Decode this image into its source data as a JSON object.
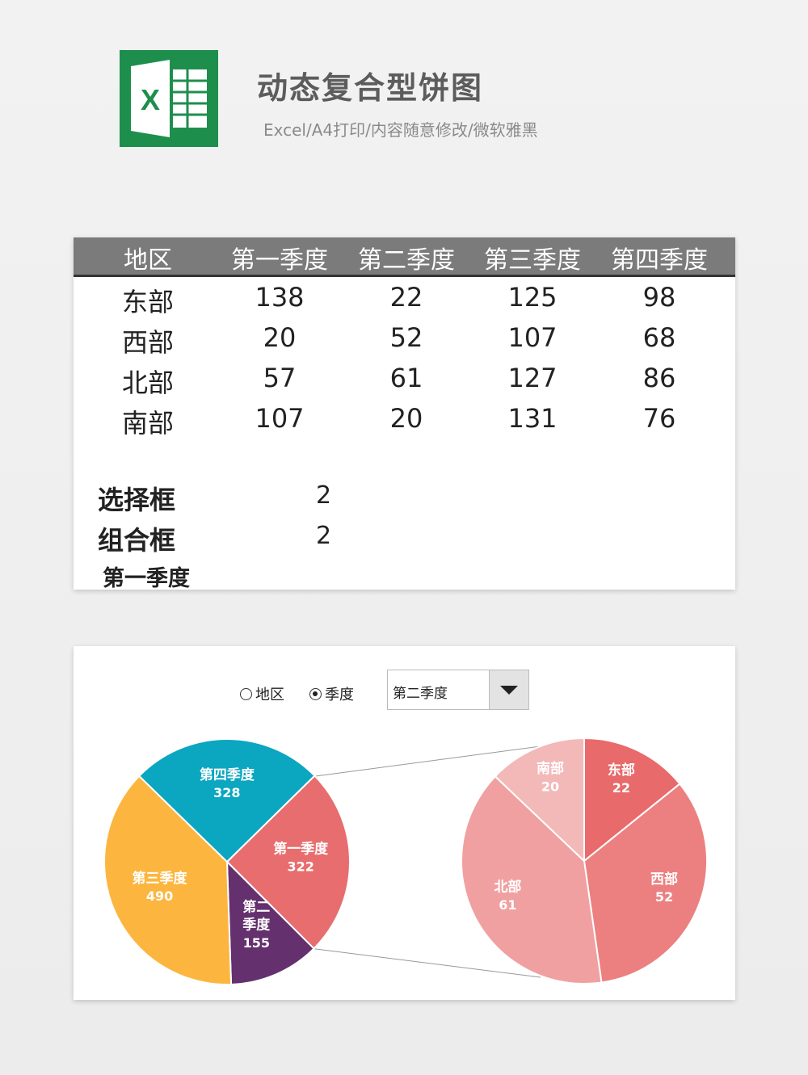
{
  "header": {
    "title": "动态复合型饼图",
    "subtitle": "Excel/A4打印/内容随意修改/微软雅黑",
    "logo_icon": "excel-logo-icon",
    "logo_letter": "X",
    "logo_color": "#1e8e4d"
  },
  "table": {
    "headers": [
      "地区",
      "第一季度",
      "第二季度",
      "第三季度",
      "第四季度"
    ],
    "rows": [
      {
        "region": "东部",
        "values": [
          "138",
          "22",
          "125",
          "98"
        ]
      },
      {
        "region": "西部",
        "values": [
          "20",
          "52",
          "107",
          "68"
        ]
      },
      {
        "region": "北部",
        "values": [
          "57",
          "61",
          "127",
          "86"
        ]
      },
      {
        "region": "南部",
        "values": [
          "107",
          "20",
          "131",
          "76"
        ]
      }
    ],
    "header_color": "#7b7b7b"
  },
  "controls": {
    "option_label": "选择框",
    "option_value": "2",
    "combo_label": "组合框",
    "combo_value": "2",
    "current_selection": "第一季度"
  },
  "chart_panel": {
    "radio_region": "地区",
    "radio_quarter": "季度",
    "selected_radio": "季度",
    "combo_selected": "第二季度"
  },
  "chart_data": [
    {
      "type": "pie",
      "title": "",
      "slices": [
        {
          "label": "第一季度",
          "value": 322,
          "color": "#e86d6e"
        },
        {
          "label": "第二季度",
          "value": 155,
          "color": "#64306e"
        },
        {
          "label": "第三季度",
          "value": 490,
          "color": "#fcb63f"
        },
        {
          "label": "第四季度",
          "value": 328,
          "color": "#0ba6c0"
        }
      ]
    },
    {
      "type": "pie",
      "title": "",
      "slices": [
        {
          "label": "东部",
          "value": 22,
          "color": "#e96a6b"
        },
        {
          "label": "西部",
          "value": 52,
          "color": "#ec8080"
        },
        {
          "label": "北部",
          "value": 61,
          "color": "#f0a0a0"
        },
        {
          "label": "南部",
          "value": 20,
          "color": "#f3b8b8"
        }
      ]
    }
  ]
}
